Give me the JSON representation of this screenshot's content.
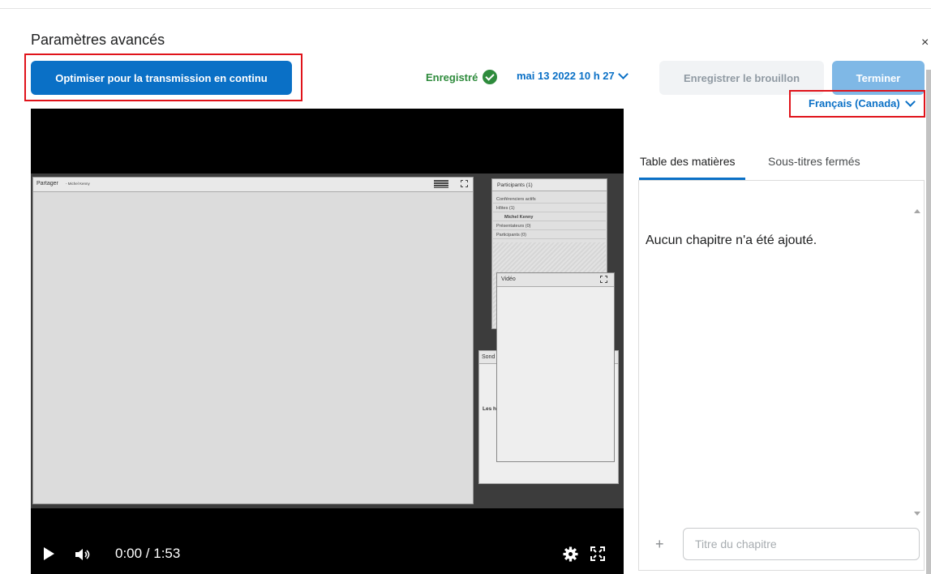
{
  "dialog": {
    "title": "Paramètres avancés",
    "close_glyph": "×"
  },
  "toolbar": {
    "optimize_label": "Optimiser pour la transmission en continu",
    "saved_label": "Enregistré",
    "date_label": "mai 13 2022 10 h 27",
    "save_draft_label": "Enregistrer le brouillon",
    "finish_label": "Terminer"
  },
  "colors": {
    "primary": "#0a70c6",
    "success": "#2e8b3c",
    "highlight": "#e0131a",
    "disabled_primary": "#7fb8e6"
  },
  "player": {
    "share_title": "Partager",
    "share_presenter": "- Michel Kenny",
    "participants_title": "Participants",
    "participants_count": "(1)",
    "participants_rows": [
      "Conférenciers actifs",
      "Hôtes (1)",
      "Michel Kenny",
      "Présentateurs (0)",
      "Participants (0)"
    ],
    "video_panel_title": "Vidéo",
    "poll_title": "Sond",
    "poll_text": "Les h",
    "time": "0:00 / 1:53"
  },
  "sidepanel": {
    "language": "Français (Canada)",
    "tabs": [
      {
        "label": "Table des matières",
        "active": true
      },
      {
        "label": "Sous-titres fermés",
        "active": false
      }
    ],
    "empty_message": "Aucun chapitre n'a été ajouté.",
    "chapter_placeholder": "Titre du chapitre",
    "add_glyph": "+"
  }
}
